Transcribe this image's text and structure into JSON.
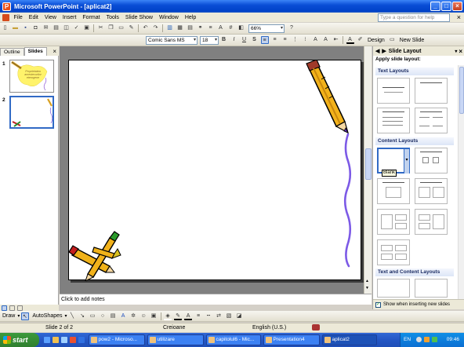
{
  "window": {
    "title": "Microsoft PowerPoint - [aplicat2]"
  },
  "menu": [
    "File",
    "Edit",
    "View",
    "Insert",
    "Format",
    "Tools",
    "Slide Show",
    "Window",
    "Help"
  ],
  "help_placeholder": "Type a question for help",
  "toolbar": {
    "zoom": "66%",
    "font": "Comic Sans MS",
    "size": "18",
    "design": "Design",
    "new_slide": "New Slide"
  },
  "left_panel": {
    "tabs": [
      "Outline",
      "Slides"
    ],
    "slides": [
      "1",
      "2"
    ],
    "slide1_text": "Proprietatea amestecurilor eterogene"
  },
  "notes_placeholder": "Click to add notes",
  "task_pane": {
    "title": "Slide Layout",
    "apply_label": "Apply slide layout:",
    "groups": [
      "Text Layouts",
      "Content Layouts",
      "Text and Content Layouts"
    ],
    "tooltip": "Blank",
    "checkbox_label": "Show when inserting new slides",
    "checkbox_checked": true
  },
  "drawing": {
    "draw": "Draw",
    "autoshapes": "AutoShapes"
  },
  "status": {
    "slide": "Slide 2 of 2",
    "design": "Creioane",
    "language": "English (U.S.)"
  },
  "taskbar": {
    "start": "start",
    "tasks": [
      "pow2 - Microso...",
      "utilizare",
      "capitolul6 - Mic...",
      "Presentation4",
      "aplicat2"
    ],
    "language": "EN",
    "clock": "09:46"
  }
}
